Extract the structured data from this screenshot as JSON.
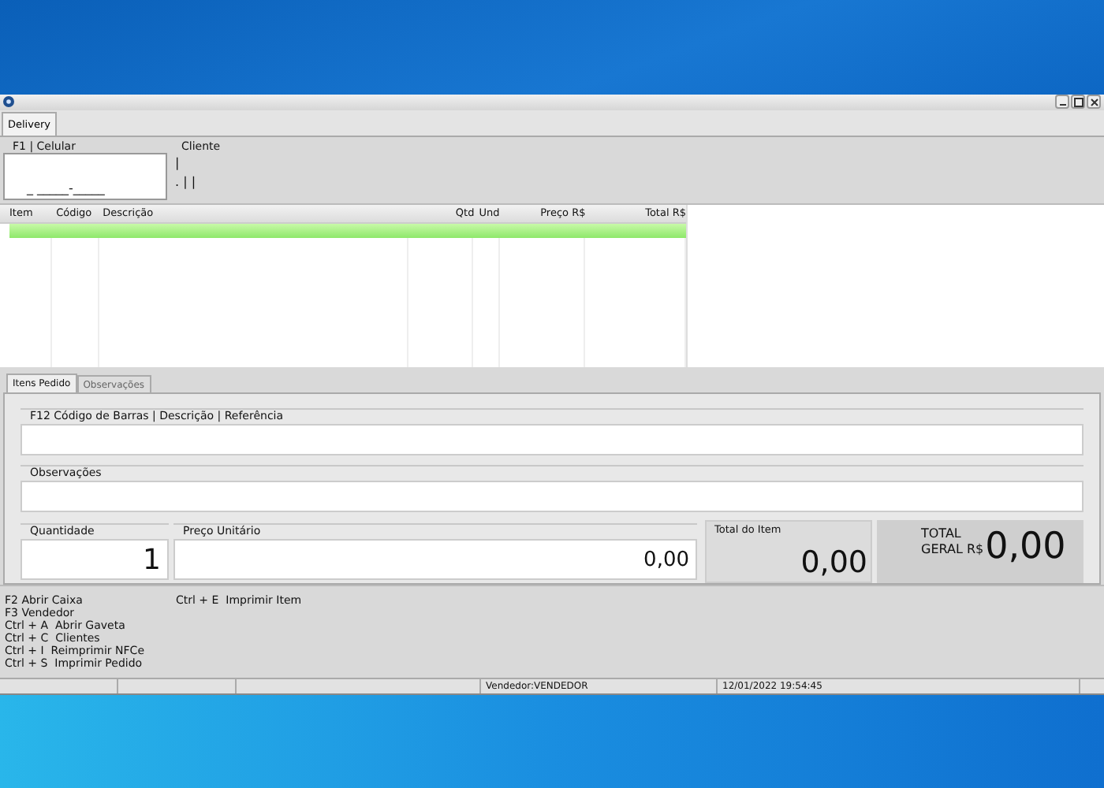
{
  "window": {
    "tabs": [
      {
        "label": "Delivery",
        "selected": true
      }
    ]
  },
  "header": {
    "phone": {
      "label": "F1 | Celular",
      "value": "_ _____-_____"
    },
    "client": {
      "label": "Cliente",
      "line_1": "|",
      "line_2": ". | |"
    }
  },
  "table": {
    "columns": [
      "Item",
      "Código",
      "Descrição",
      "Qtd",
      "Und",
      "Preço R$",
      "Total R$"
    ],
    "rows": [
      {
        "selected": true
      }
    ]
  },
  "item_tabs": [
    {
      "label": "Itens Pedido",
      "selected": true
    },
    {
      "label": "Observações",
      "selected": false
    }
  ],
  "form": {
    "search": {
      "label": "F12 Código de Barras | Descrição | Referência"
    },
    "notes": {
      "label": "Observações"
    },
    "quantity": {
      "label": "Quantidade",
      "value": "1"
    },
    "unit_price": {
      "label": "Preço Unitário",
      "value": "0,00"
    },
    "item_total": {
      "label": "Total do Item",
      "value": "0,00"
    },
    "grand_total": {
      "label_1": "TOTAL",
      "label_2": "GERAL R$",
      "value": "0,00"
    }
  },
  "shortcuts": {
    "column_1": [
      "F2 Abrir Caixa",
      "F3 Vendedor",
      "Ctrl + A  Abrir Gaveta",
      "Ctrl + C  Clientes",
      "Ctrl + I  Reimprimir NFCe",
      "Ctrl + S  Imprimir Pedido"
    ],
    "column_2": [
      "Ctrl + E  Imprimir Item"
    ]
  },
  "status_bar": {
    "seller": "Vendedor:VENDEDOR",
    "datetime": "12/01/2022 19:54:45"
  }
}
